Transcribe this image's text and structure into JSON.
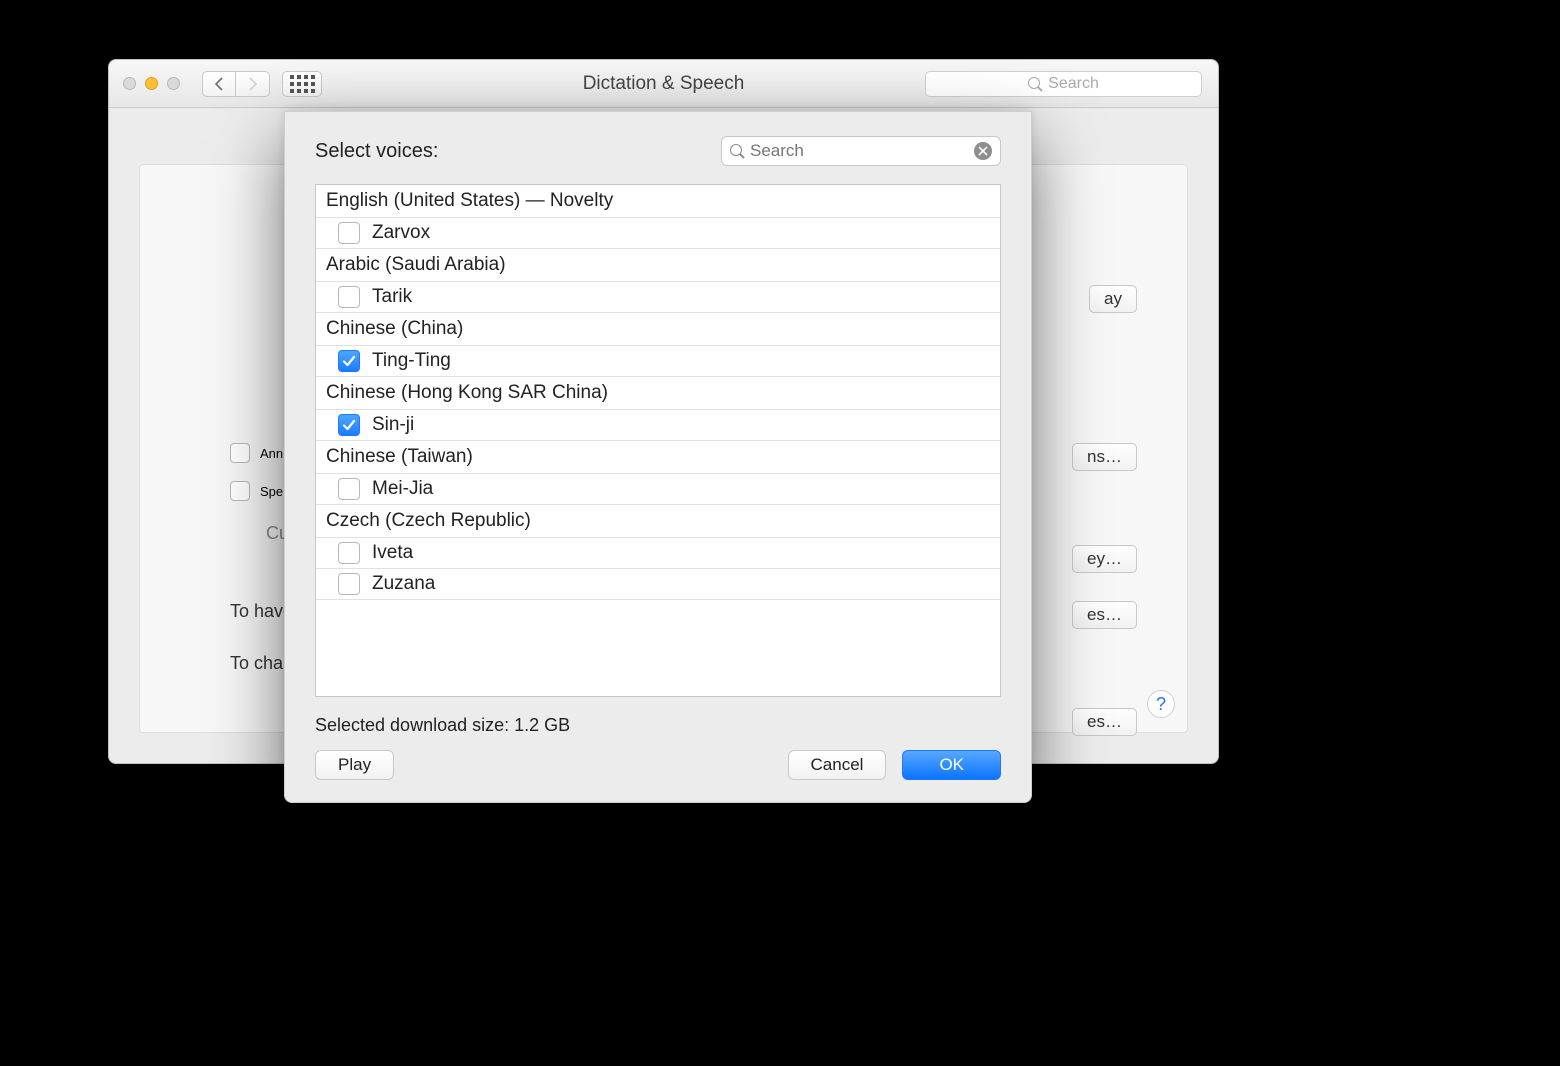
{
  "window": {
    "title": "Dictation & Speech",
    "search_placeholder": "Search"
  },
  "background": {
    "announce_label": "Ann",
    "speak_label": "Spe",
    "current_label": "Cur",
    "to_have_label": "To have",
    "to_cha_label": "To cha",
    "play_label": "ay",
    "opts_label": "ns…",
    "key_label": "ey…",
    "es1_label": "es…",
    "es2_label": "es…"
  },
  "sheet": {
    "label": "Select voices:",
    "search_placeholder": "Search",
    "download_size": "Selected download size: 1.2 GB",
    "play": "Play",
    "cancel": "Cancel",
    "ok": "OK",
    "groups": [
      {
        "header": "English (United States) — Novelty",
        "voices": [
          {
            "name": "Zarvox",
            "checked": false
          }
        ]
      },
      {
        "header": "Arabic (Saudi Arabia)",
        "voices": [
          {
            "name": "Tarik",
            "checked": false
          }
        ]
      },
      {
        "header": "Chinese (China)",
        "voices": [
          {
            "name": "Ting-Ting",
            "checked": true
          }
        ]
      },
      {
        "header": "Chinese (Hong Kong SAR China)",
        "voices": [
          {
            "name": "Sin-ji",
            "checked": true
          }
        ]
      },
      {
        "header": "Chinese (Taiwan)",
        "voices": [
          {
            "name": "Mei-Jia",
            "checked": false
          }
        ]
      },
      {
        "header": "Czech (Czech Republic)",
        "voices": [
          {
            "name": "Iveta",
            "checked": false
          },
          {
            "name": "Zuzana",
            "checked": false
          }
        ]
      }
    ]
  }
}
